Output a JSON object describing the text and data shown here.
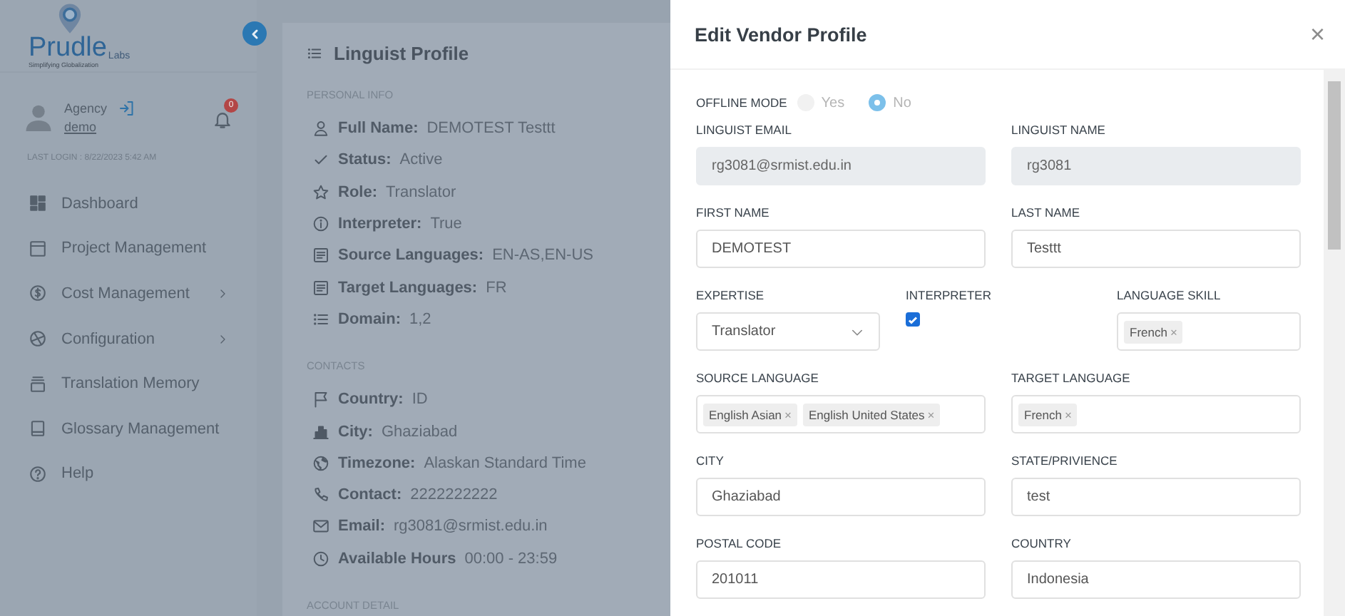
{
  "sidebar": {
    "logo": {
      "name": "Prudle",
      "suffix": "Labs",
      "tagline": "Simplifying Globalization"
    },
    "user": {
      "role": "Agency",
      "name": "demo"
    },
    "notifications": "0",
    "last_login": "LAST LOGIN : 8/22/2023 5:42 AM",
    "nav": [
      {
        "kind": "grid",
        "label": "Dashboard",
        "expandable": false
      },
      {
        "kind": "window",
        "label": "Project Management",
        "expandable": false
      },
      {
        "kind": "dollar",
        "label": "Cost Management",
        "expandable": true
      },
      {
        "kind": "aperture",
        "label": "Configuration",
        "expandable": true
      },
      {
        "kind": "stack",
        "label": "Translation Memory",
        "expandable": false
      },
      {
        "kind": "book",
        "label": "Glossary Management",
        "expandable": false
      },
      {
        "kind": "help",
        "label": "Help",
        "expandable": false
      }
    ]
  },
  "profile": {
    "title": "Linguist Profile",
    "sections": [
      {
        "heading": "PERSONAL INFO",
        "items": [
          {
            "kind": "person",
            "label": "Full Name:",
            "value": "DEMOTEST Testtt"
          },
          {
            "kind": "check",
            "label": "Status:",
            "value": "Active"
          },
          {
            "kind": "star",
            "label": "Role:",
            "value": "Translator"
          },
          {
            "kind": "info",
            "label": "Interpreter:",
            "value": "True"
          },
          {
            "kind": "doc",
            "label": "Source Languages:",
            "value": "EN-AS,EN-US"
          },
          {
            "kind": "doc",
            "label": "Target Languages:",
            "value": "FR"
          },
          {
            "kind": "list",
            "label": "Domain:",
            "value": "1,2"
          }
        ]
      },
      {
        "heading": "CONTACTS",
        "items": [
          {
            "kind": "flag",
            "label": "Country:",
            "value": "ID"
          },
          {
            "kind": "building",
            "label": "City:",
            "value": "Ghaziabad"
          },
          {
            "kind": "globe",
            "label": "Timezone:",
            "value": "Alaskan Standard Time"
          },
          {
            "kind": "phone",
            "label": "Contact:",
            "value": "2222222222"
          },
          {
            "kind": "mail",
            "label": "Email:",
            "value": "rg3081@srmist.edu.in"
          },
          {
            "kind": "clock",
            "label": "Available Hours",
            "value": "00:00 - 23:59"
          }
        ]
      },
      {
        "heading": "ACCOUNT DETAIL"
      }
    ]
  },
  "modal": {
    "title": "Edit Vendor Profile",
    "close": "×",
    "offline_mode": {
      "label": "OFFLINE MODE",
      "options": [
        {
          "label": "Yes",
          "selected": false
        },
        {
          "label": "No",
          "selected": true
        }
      ]
    },
    "rows": [
      {
        "fields": [
          {
            "kind": "text",
            "label": "LINGUIST EMAIL",
            "value": "rg3081@srmist.edu.in",
            "disabled": true
          },
          {
            "kind": "text",
            "label": "LINGUIST NAME",
            "value": "rg3081",
            "disabled": true
          }
        ]
      },
      {
        "fields": [
          {
            "kind": "text",
            "label": "FIRST NAME",
            "value": "DEMOTEST",
            "disabled": false
          },
          {
            "kind": "text",
            "label": "LAST NAME",
            "value": "Testtt",
            "disabled": false
          }
        ]
      },
      {
        "fields": [
          {
            "kind": "select",
            "label": "EXPERTISE",
            "value": "Translator"
          },
          {
            "kind": "checkbox",
            "label": "INTERPRETER",
            "checked": true
          },
          {
            "kind": "tags",
            "label": "LANGUAGE SKILL",
            "tags": [
              {
                "label": "French",
                "remove": "×"
              }
            ]
          }
        ]
      },
      {
        "fields": [
          {
            "kind": "tags",
            "label": "SOURCE LANGUAGE",
            "tags": [
              {
                "label": "English Asian",
                "remove": "×"
              },
              {
                "label": "English United States",
                "remove": "×"
              }
            ]
          },
          {
            "kind": "tags",
            "label": "TARGET LANGUAGE",
            "tags": [
              {
                "label": "French",
                "remove": "×"
              }
            ]
          }
        ]
      },
      {
        "fields": [
          {
            "kind": "text",
            "label": "CITY",
            "value": "Ghaziabad",
            "disabled": false
          },
          {
            "kind": "text",
            "label": "STATE/PRIVIENCE",
            "value": "test",
            "disabled": false
          }
        ]
      },
      {
        "fields": [
          {
            "kind": "text",
            "label": "POSTAL CODE",
            "value": "201011",
            "disabled": false
          },
          {
            "kind": "text",
            "label": "COUNTRY",
            "value": "Indonesia",
            "disabled": false
          }
        ]
      }
    ]
  }
}
